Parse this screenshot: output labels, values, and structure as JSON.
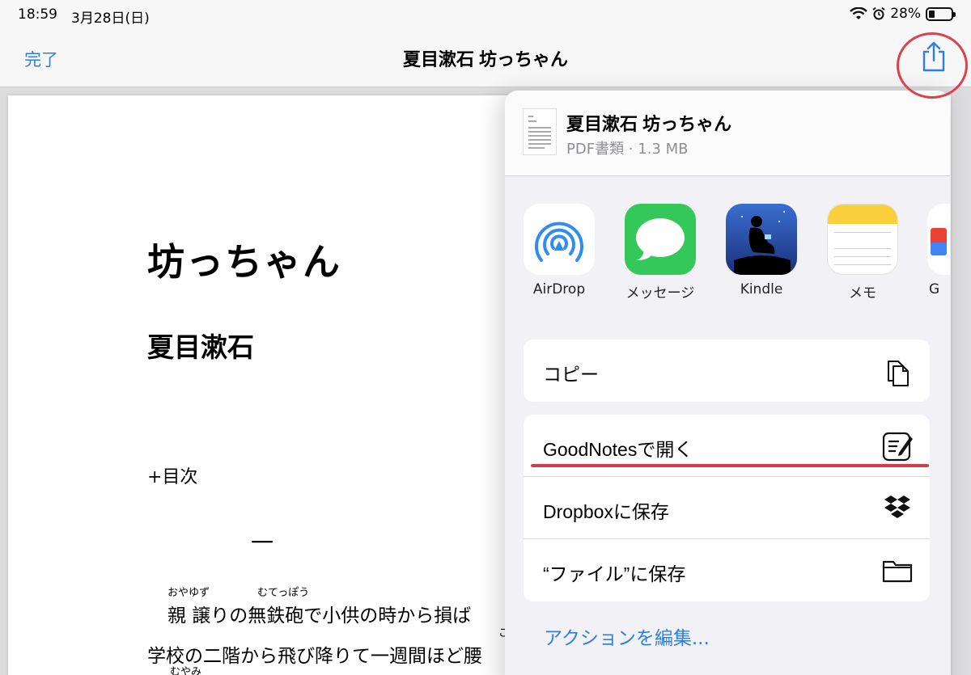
{
  "status_bar": {
    "time": "18:59",
    "date": "3月28日(日)",
    "battery": "28%"
  },
  "nav": {
    "done_label": "完了",
    "title": "夏目漱石 坊っちゃん"
  },
  "pdf": {
    "title": "坊っちゃん",
    "author": "夏目漱石",
    "toc": "+目次",
    "chapter": "一",
    "ruby1": "おやゆず",
    "ruby2": "むてっぽう",
    "line1": "親 譲りの無鉄砲で小供の時から損ば",
    "ruby3": "こ",
    "line2": "学校の二階から飛び降りて一週間ほど腰",
    "ruby4": "むやみ"
  },
  "sheet": {
    "doc_title": "夏目漱石 坊っちゃん",
    "doc_subtitle": "PDF書類 · 1.3 MB",
    "apps": [
      {
        "label": "AirDrop",
        "icon": "airdrop-icon"
      },
      {
        "label": "メッセージ",
        "icon": "messages-icon"
      },
      {
        "label": "Kindle",
        "icon": "kindle-icon"
      },
      {
        "label": "メモ",
        "icon": "notes-icon"
      },
      {
        "label": "G",
        "icon": "partial-app-icon"
      }
    ],
    "actions_group1": [
      {
        "label": "コピー",
        "icon": "copy-icon"
      }
    ],
    "actions_group2": [
      {
        "label": "GoodNotesで開く",
        "icon": "goodnotes-icon"
      },
      {
        "label": "Dropboxに保存",
        "icon": "dropbox-icon"
      },
      {
        "label": "“ファイル”に保存",
        "icon": "folder-icon"
      }
    ],
    "edit_actions": "アクションを編集..."
  },
  "colors": {
    "accent": "#2f7fe0",
    "highlight": "#d9434e",
    "messages_green": "#34c759"
  }
}
